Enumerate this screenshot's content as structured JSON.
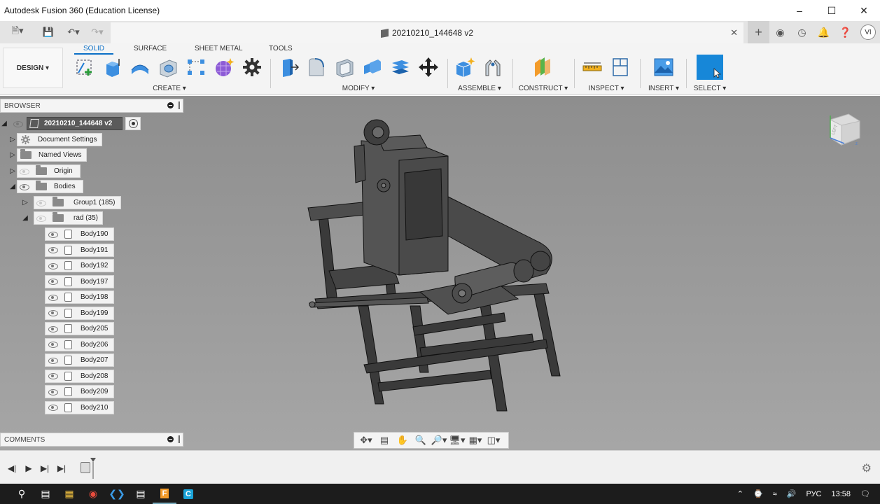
{
  "window": {
    "title": "Autodesk Fusion 360 (Education License)",
    "minimize_icon": "minimize-icon",
    "maximize_icon": "maximize-icon",
    "close_icon": "close-icon"
  },
  "document_tab": {
    "name": "20210210_144648 v2"
  },
  "toolbar_tabs": [
    {
      "label": "SOLID",
      "active": true
    },
    {
      "label": "SURFACE",
      "active": false
    },
    {
      "label": "SHEET METAL",
      "active": false
    },
    {
      "label": "TOOLS",
      "active": false
    }
  ],
  "workspace": {
    "label": "DESIGN ▾"
  },
  "tool_groups": [
    {
      "label": "CREATE ▾"
    },
    {
      "label": "MODIFY ▾"
    },
    {
      "label": "ASSEMBLE ▾"
    },
    {
      "label": "CONSTRUCT ▾"
    },
    {
      "label": "INSPECT ▾"
    },
    {
      "label": "INSERT ▾"
    },
    {
      "label": "SELECT ▾"
    }
  ],
  "browser": {
    "title": "BROWSER",
    "root": "20210210_144648 v2",
    "items": [
      {
        "label": "Document Settings"
      },
      {
        "label": "Named Views"
      },
      {
        "label": "Origin"
      },
      {
        "label": "Bodies"
      },
      {
        "label": "Group1 (185)"
      },
      {
        "label": "rad (35)"
      }
    ],
    "bodies": [
      "Body190",
      "Body191",
      "Body192",
      "Body197",
      "Body198",
      "Body199",
      "Body205",
      "Body206",
      "Body207",
      "Body208",
      "Body209",
      "Body210"
    ]
  },
  "comments": {
    "title": "COMMENTS"
  },
  "viewcube": {
    "face": "LEFT"
  },
  "user": {
    "initials": "VI"
  },
  "taskbar": {
    "language": "РУС",
    "time": "13:58"
  },
  "colors": {
    "accent": "#0b6fc6",
    "select_button": "#1787d8",
    "viewport_top": "#8e8e8e",
    "viewport_bottom": "#a6a6a6"
  }
}
